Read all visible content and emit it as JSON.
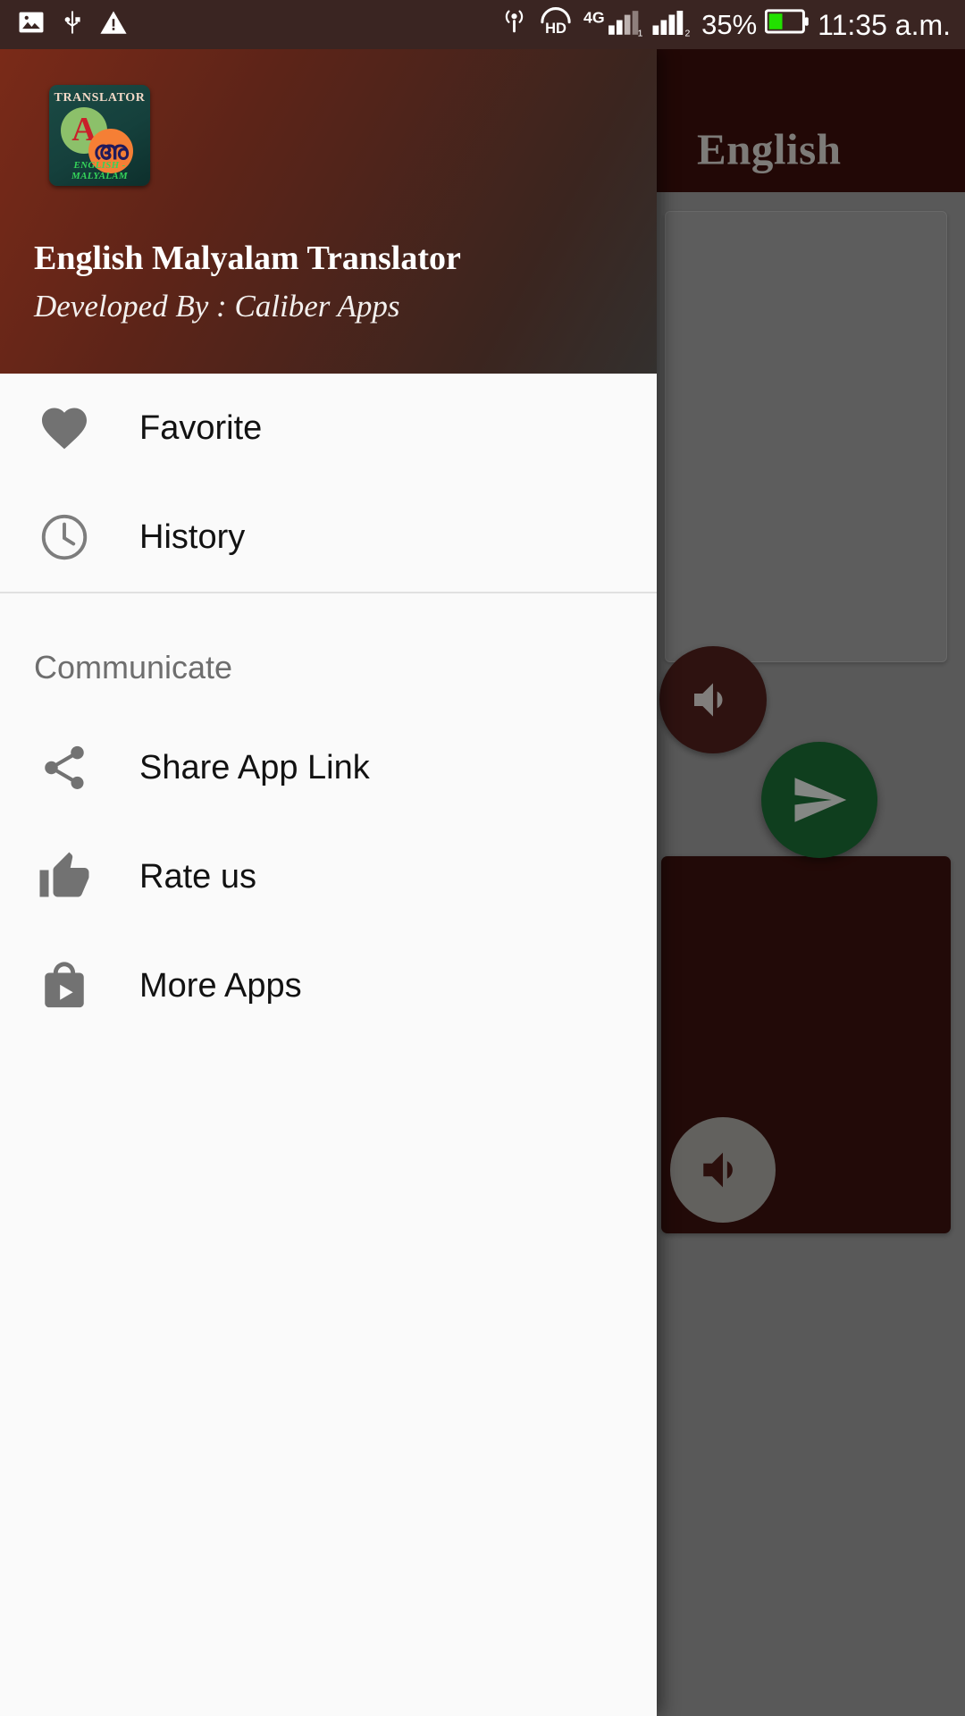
{
  "statusbar": {
    "left_icons": [
      "image-icon",
      "usb-icon",
      "warning-icon"
    ],
    "right_icons": [
      "nfc-icon",
      "hd-voice-icon",
      "signal-4g-icon",
      "signal-bars-icon",
      "battery-icon"
    ],
    "network_label": "4G",
    "hd_label": "HD",
    "battery_percent": "35%",
    "time": "11:35 a.m."
  },
  "background_app": {
    "toolbar_title": "English",
    "input_card": {
      "text": "",
      "speaker_icon": "volume-up-icon"
    },
    "translate_fab": {
      "icon": "send-icon",
      "color": "#1b6b34"
    },
    "output_card": {
      "text": "",
      "speaker_icon": "volume-up-icon",
      "color": "#3c120e"
    }
  },
  "drawer": {
    "logo": {
      "title": "TRANSLATOR",
      "letter_english": "A",
      "letter_malayalam": "അ",
      "subtitle": "ENGLISH - MALYALAM"
    },
    "app_name": "English Malyalam Translator",
    "developer": "Developed By : Caliber Apps",
    "primary_items": [
      {
        "label": "Favorite",
        "icon": "heart-icon"
      },
      {
        "label": "History",
        "icon": "clock-icon"
      }
    ],
    "section_title": "Communicate",
    "communicate_items": [
      {
        "label": "Share App Link",
        "icon": "share-icon"
      },
      {
        "label": "Rate us",
        "icon": "thumb-up-icon"
      },
      {
        "label": "More Apps",
        "icon": "play-store-bag-icon"
      }
    ]
  },
  "colors": {
    "brand_maroon": "#3b0f0c",
    "drawer_bg": "#fafafa",
    "accent_green": "#1b6b34",
    "icon_gray": "#727272"
  }
}
